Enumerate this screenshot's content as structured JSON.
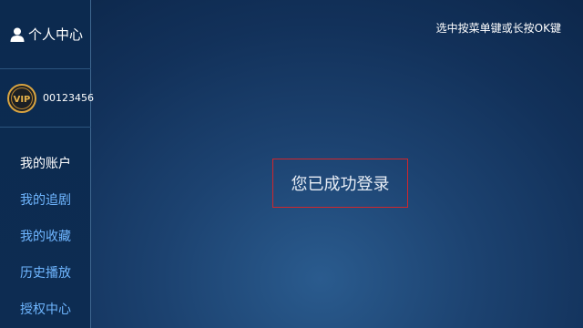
{
  "sidebar": {
    "header": {
      "icon": "user-icon",
      "title": "个人中心"
    },
    "account": {
      "badge_text": "VIP",
      "id": "00123456"
    },
    "menu": [
      {
        "label": "我的账户",
        "active": true
      },
      {
        "label": "我的追剧",
        "active": false
      },
      {
        "label": "我的收藏",
        "active": false
      },
      {
        "label": "历史播放",
        "active": false
      },
      {
        "label": "授权中心",
        "active": false
      }
    ]
  },
  "main": {
    "hint": "选中按菜单键或长按OK键",
    "status_message": "您已成功登录"
  },
  "colors": {
    "accent_text": "#6fb6ff",
    "highlight_border": "#d1262b",
    "vip_gold": "#d9a441"
  }
}
